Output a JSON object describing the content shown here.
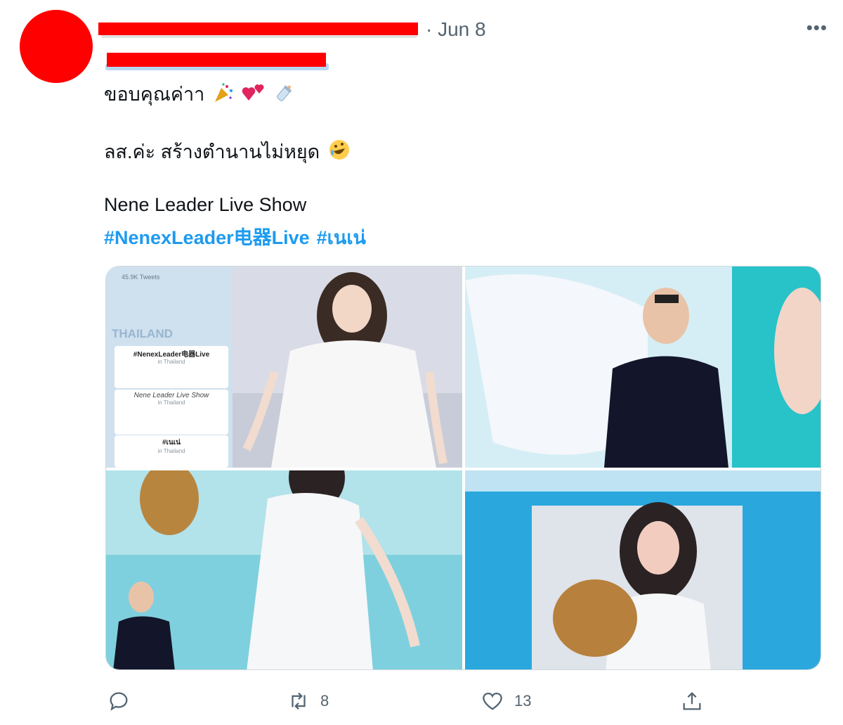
{
  "author": {
    "date": "· Jun 8"
  },
  "tweet": {
    "line1": "ขอบคุณค่าา",
    "line2": "ลส.ค่ะ สร้างตำนานไม่หยุด",
    "line3": "Nene Leader Live Show",
    "hashtags": [
      "#NenexLeader电器Live",
      "#เนเน่"
    ]
  },
  "media": {
    "trend_panel": {
      "tweet_count": "45.9K Tweets",
      "country": "THAILAND",
      "trend_1": "#NenexLeader电器Live",
      "trend_1_sub": "in Thailand",
      "trend_2": "Nene Leader Live Show",
      "trend_2_sub": "in Thailand",
      "trend_3": "#เนเน่",
      "trend_3_sub": "in Thailand"
    }
  },
  "actions": {
    "reply_count": "",
    "retweet_count": "8",
    "like_count": "13"
  },
  "colors": {
    "link": "#1d9bf0",
    "muted": "#536471",
    "redaction": "#ff0000"
  },
  "icons": [
    "more-icon",
    "reply-icon",
    "retweet-icon",
    "like-icon",
    "share-icon",
    "party-popper-emoji",
    "two-hearts-emoji",
    "baby-bottle-emoji",
    "rolling-laughing-emoji"
  ]
}
